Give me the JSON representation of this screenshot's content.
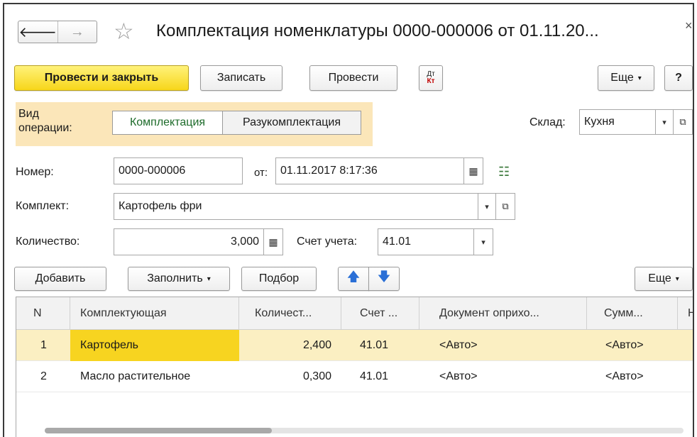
{
  "window": {
    "title": "Комплектация номенклатуры 0000-000006 от 01.11.20...",
    "close_glyph": "×"
  },
  "nav": {
    "back_glyph": "🡐",
    "forward_glyph": "→",
    "star_glyph": "☆"
  },
  "toolbar": {
    "post_close": "Провести и закрыть",
    "save": "Записать",
    "post": "Провести",
    "dtkt_top": "Дт",
    "dtkt_bottom": "Кт",
    "more": "Еще",
    "help": "?"
  },
  "op_type": {
    "label_line1": "Вид",
    "label_line2": "операции:",
    "options": [
      "Комплектация",
      "Разукомплектация"
    ],
    "selected": "Комплектация"
  },
  "warehouse": {
    "label": "Склад:",
    "value": "Кухня"
  },
  "number": {
    "label": "Номер:",
    "value": "0000-000006",
    "date_label": "от:",
    "date_value": "01.11.2017  8:17:36"
  },
  "kit": {
    "label": "Комплект:",
    "value": "Картофель фри"
  },
  "quantity": {
    "label": "Количество:",
    "value": "3,000",
    "account_label": "Счет учета:",
    "account_value": "41.01"
  },
  "table_toolbar": {
    "add": "Добавить",
    "fill": "Заполнить",
    "pick": "Подбор",
    "up_glyph": "🡅",
    "down_glyph": "🡇",
    "more": "Еще"
  },
  "table": {
    "columns": [
      "N",
      "Комплектующая",
      "Количест...",
      "Счет ...",
      "Документ оприхо...",
      "Сумм...",
      "Н"
    ],
    "rows": [
      {
        "n": "1",
        "component": "Картофель",
        "qty": "2,400",
        "account": "41.01",
        "doc": "<Авто>",
        "sum": "<Авто>"
      },
      {
        "n": "2",
        "component": "Масло растительное",
        "qty": "0,300",
        "account": "41.01",
        "doc": "<Авто>",
        "sum": "<Авто>"
      }
    ]
  },
  "colors": {
    "primary": "#f7d61a",
    "op_bg": "#fbe6b9",
    "selected_row": "#fbefc2",
    "active_cell": "#f7d420",
    "arrow_blue": "#2a6fd6"
  }
}
